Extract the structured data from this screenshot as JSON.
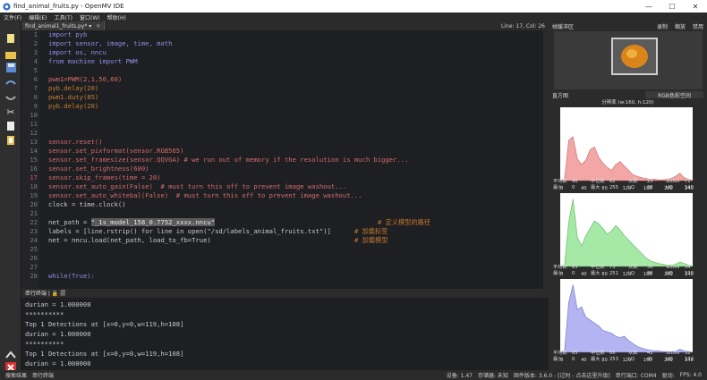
{
  "window": {
    "title": "find_animal_fruits.py - OpenMV IDE",
    "minimize": "—",
    "maximize": "☐",
    "close": "✕"
  },
  "menu": [
    "文件(F)",
    "编辑(E)",
    "工具(T)",
    "窗口(W)",
    "帮助(H)"
  ],
  "toolbar": {
    "icons": [
      "new-file-icon",
      "open-file-icon",
      "save-icon",
      "undo-icon",
      "redo-icon",
      "cut-icon",
      "copy-icon",
      "paste-icon",
      "connect-icon",
      "stop-icon"
    ]
  },
  "tab": {
    "name": "find_animal1_fruits.py* ▾",
    "close": "✕",
    "position": "Line: 17, Col: 26"
  },
  "editor": {
    "line_numbers": [
      "1",
      "2",
      "3",
      "4",
      "5",
      "6",
      "7",
      "8",
      "9",
      "10",
      "11",
      "12",
      "13",
      "14",
      "15",
      "16",
      "17",
      "18",
      "19",
      "20",
      "21",
      "22",
      "23",
      "24",
      "25",
      "26",
      "27",
      "28"
    ],
    "current_line": "17",
    "lines": [
      {
        "t": "import pyb",
        "c": "kw"
      },
      {
        "t": "import sensor, image, time, math",
        "c": "kw"
      },
      {
        "t": "import os, nncu",
        "c": "kw"
      },
      {
        "t": "from machine import PWM",
        "c": "kw"
      },
      {
        "t": "",
        "c": "pl"
      },
      {
        "t": "pwm1=PWM(2,1,50,60)",
        "c": "fn"
      },
      {
        "t": "pyb.delay(20)",
        "c": "num"
      },
      {
        "t": "pwm1.duty(85)",
        "c": "num"
      },
      {
        "t": "pyb.delay(20)",
        "c": "num"
      },
      {
        "t": "",
        "c": "pl"
      },
      {
        "t": "",
        "c": "pl"
      },
      {
        "t": "",
        "c": "pl"
      },
      {
        "t": "sensor.reset()",
        "c": "fn"
      },
      {
        "t": "sensor.set_pixformat(sensor.RGB565)",
        "c": "fn"
      },
      {
        "t": "sensor.set_framesize(sensor.QQVGA) # we run out of memory if the resolution is much bigger...",
        "c": "fn"
      },
      {
        "t": "sensor.set_brightness(600)",
        "c": "fn"
      },
      {
        "t": "sensor.skip_frames(time = 20)",
        "c": "fn"
      },
      {
        "t": "sensor.set_auto_gain(False)  # must turn this off to prevent image washout...",
        "c": "fn"
      },
      {
        "t": "sensor.set_auto_whitebal(False)  # must turn this off to prevent image washout...",
        "c": "fn"
      },
      {
        "t": "clock = time.clock()",
        "c": "pl"
      },
      {
        "t": "",
        "c": "pl"
      },
      {
        "t": "net_path = \"_1s_model_158_0.7752_xxxx.nncu\"",
        "c": "pl"
      },
      {
        "t": "labels = [line.rstrip() for line in open(\"/sd/labels_animal_fruits.txt\")]",
        "c": "pl"
      },
      {
        "t": "net = nncu.load(net_path, load_to_fb=True)",
        "c": "pl"
      },
      {
        "t": "",
        "c": "pl"
      },
      {
        "t": "",
        "c": "pl"
      },
      {
        "t": "",
        "c": "pl"
      },
      {
        "t": "while(True):",
        "c": "kw"
      }
    ],
    "comments": {
      "l22": "# 定义模型的路径",
      "l23": "# 加载标签",
      "l24": "# 加载模型"
    }
  },
  "terminal": {
    "tabs": "串行终端 | 🔒 🗐",
    "lines": [
      "durian = 1.000000",
      "**********",
      "Top 1 Detections at [x=0,y=0,w=119,h=108]",
      "durian = 1.000000",
      "**********",
      "Top 1 Detections at [x=0,y=0,w=119,h=108]",
      "durian = 1.000000"
    ]
  },
  "status": {
    "left": [
      "搜索结果",
      "串行终端"
    ],
    "right": [
      "固件版本: 3.6.0 - [过时 - 点击这里升级]",
      "串行端口: COM4",
      "驱动: ",
      "FPS: 4.0"
    ],
    "mid": [
      "设备: 1.47",
      "存储器: 未知"
    ]
  },
  "framebuffer": {
    "title": "帧缓冲区",
    "buttons": [
      "录制",
      "缩放",
      "禁用"
    ]
  },
  "histogram": {
    "title": "直方图",
    "colorspace": "RGB色彩空间",
    "resolution": "分辨率 (w:160, h:120)",
    "x_ticks": [
      "0",
      "40",
      "80",
      "120",
      "160",
      "200",
      "240"
    ],
    "channels": [
      {
        "name": "R",
        "color": "#f3a6a6",
        "line": "#c86464",
        "stats": [
          [
            "平均数",
            "96",
            "中位数",
            "82",
            "众数",
            "25",
            "StDev",
            "71"
          ],
          [
            "最小",
            "0",
            "最大",
            "255",
            "LQ",
            "38",
            "UQ",
            "140"
          ]
        ]
      },
      {
        "name": "G",
        "color": "#a6e8a6",
        "line": "#5ab45a",
        "stats": [
          [
            "平均数",
            "83",
            "中位数",
            "73",
            "众数",
            "36",
            "StDev",
            "54"
          ],
          [
            "最小",
            "0",
            "最大",
            "251",
            "LQ",
            "36",
            "UQ",
            "130"
          ]
        ]
      },
      {
        "name": "B",
        "color": "#b4b4f3",
        "line": "#6e6ec8",
        "stats": [
          [
            "平均数",
            "85",
            "中位数",
            "66",
            "众数",
            "41",
            "StDev",
            "52"
          ],
          [
            "最小",
            "0",
            "最大",
            "253",
            "LQ",
            "41",
            "UQ",
            "132"
          ]
        ]
      }
    ]
  }
}
